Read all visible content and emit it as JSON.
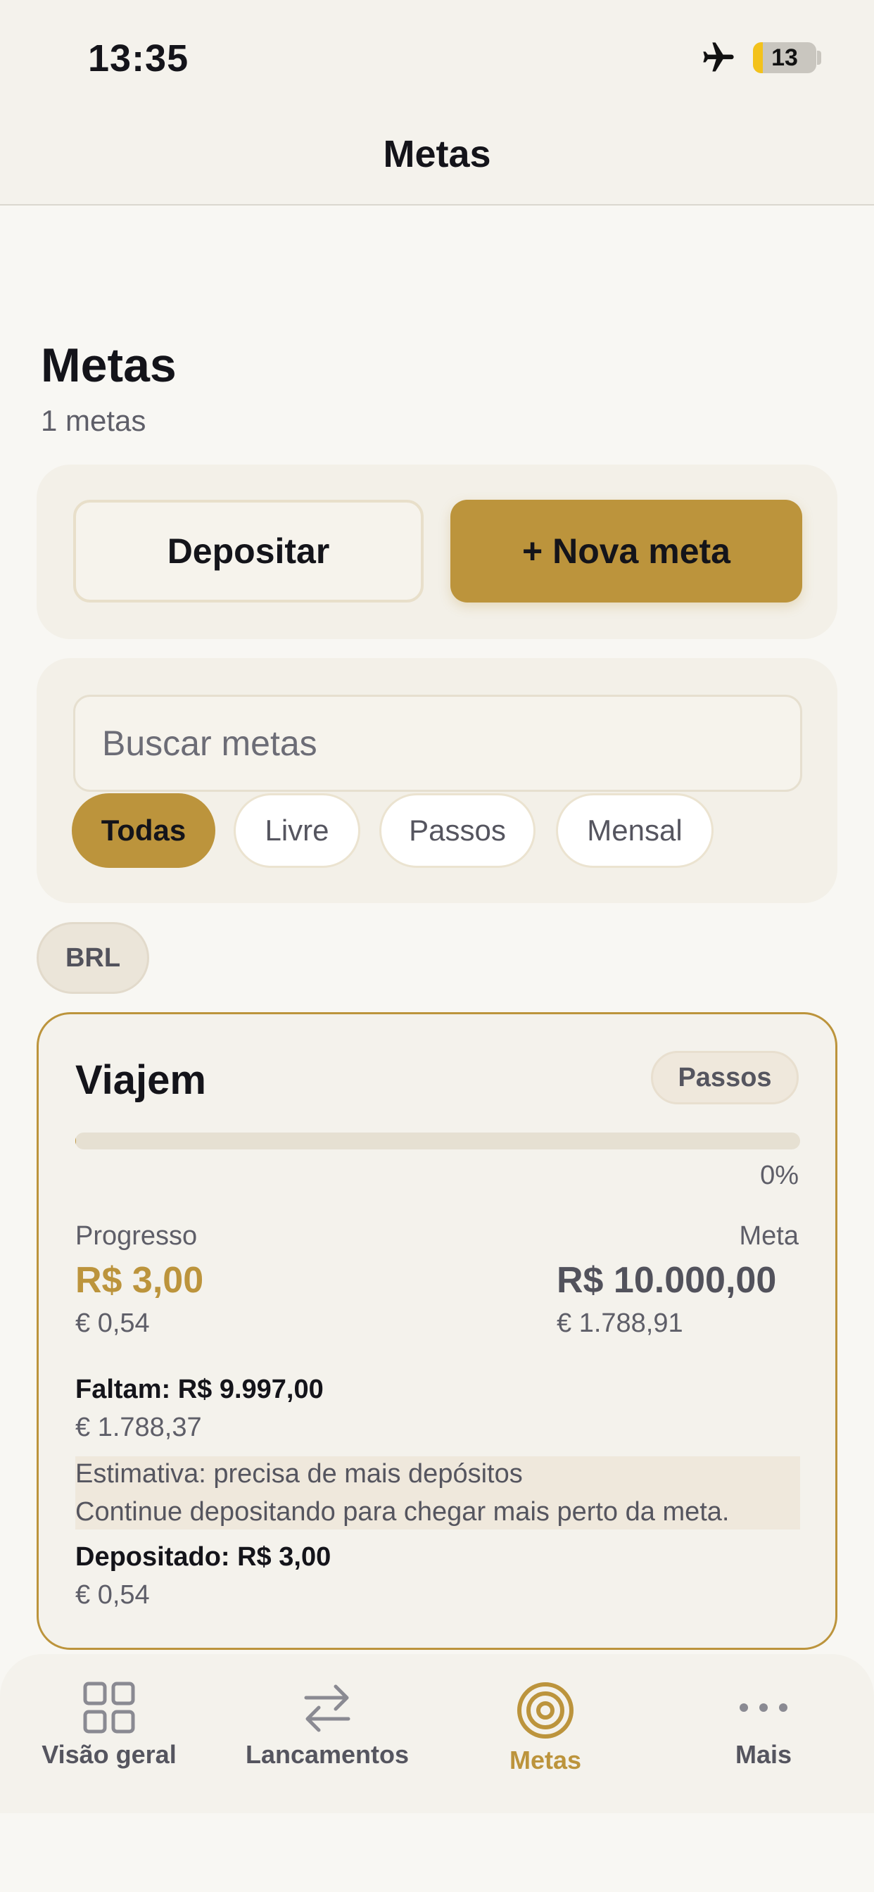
{
  "status_bar": {
    "time": "13:35",
    "battery": "13"
  },
  "header": {
    "title": "Metas"
  },
  "page": {
    "title": "Metas",
    "count": "1 metas"
  },
  "actions": {
    "deposit": "Depositar",
    "new_goal": "+ Nova meta"
  },
  "search": {
    "placeholder": "Buscar metas"
  },
  "filters": [
    "Todas",
    "Livre",
    "Passos",
    "Mensal"
  ],
  "currency": "BRL",
  "goal": {
    "name": "Viajem",
    "type": "Passos",
    "progress_fraction": 0.0003,
    "progress_pct": "0%",
    "progress_label": "Progresso",
    "progress_value": "R$ 3,00",
    "progress_eur": "€ 0,54",
    "target_label": "Meta",
    "target_value": "R$ 10.000,00",
    "target_eur": "€ 1.788,91",
    "remaining": "Faltam: R$ 9.997,00",
    "remaining_eur": "€ 1.788,37",
    "estimate_line1": "Estimativa: precisa de mais depósitos",
    "estimate_line2": "Continue depositando para chegar mais perto da meta.",
    "deposited": "Depositado: R$ 3,00",
    "deposited_eur": "€ 0,54"
  },
  "tabs": [
    {
      "label": "Visão geral",
      "icon": "grid-icon"
    },
    {
      "label": "Lancamentos",
      "icon": "arrows-swap-icon"
    },
    {
      "label": "Metas",
      "icon": "target-icon"
    },
    {
      "label": "Mais",
      "icon": "more-dots-icon"
    }
  ],
  "colors": {
    "accent": "#bc943c",
    "background": "#f8f7f3",
    "card": "#f3f0e8"
  }
}
